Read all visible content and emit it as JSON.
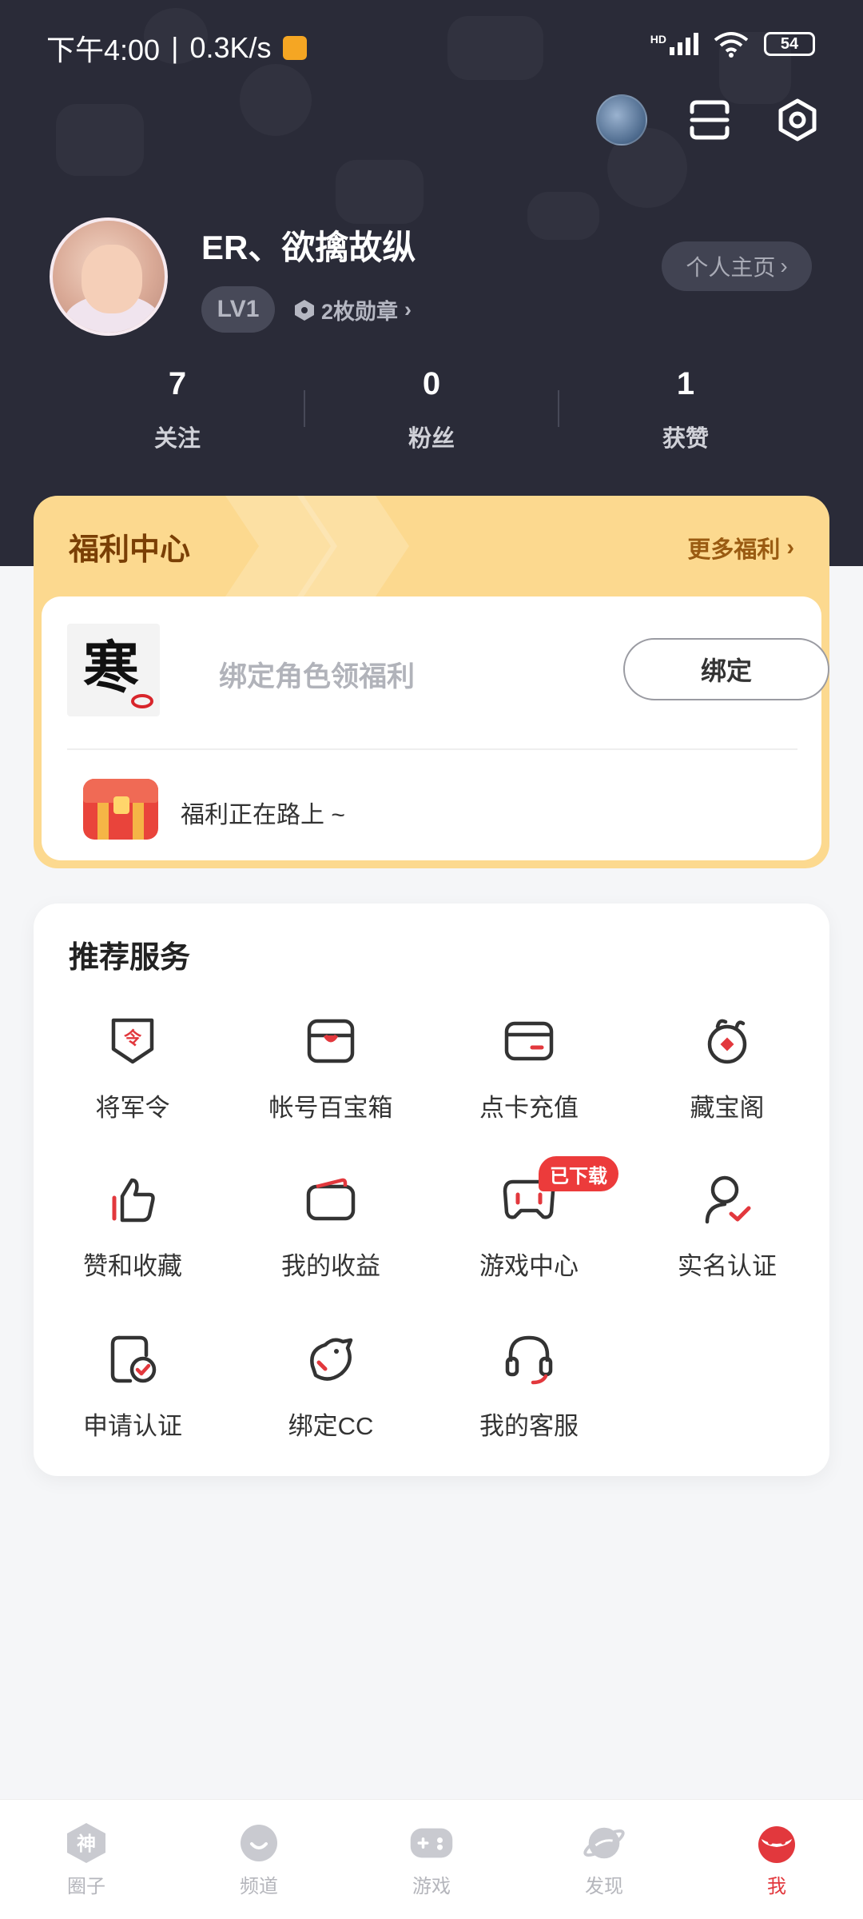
{
  "status_bar": {
    "time": "下午4:00",
    "speed": "0.3K/s",
    "network": "HD",
    "battery": "54"
  },
  "profile": {
    "username": "ER、欲擒故纵",
    "level": "LV1",
    "medals": "2枚勋章",
    "homepage_label": "个人主页"
  },
  "stats": [
    {
      "value": "7",
      "label": "关注"
    },
    {
      "value": "0",
      "label": "粉丝"
    },
    {
      "value": "1",
      "label": "获赞"
    }
  ],
  "welfare": {
    "title": "福利中心",
    "more_label": "更多福利",
    "bind_hint": "绑定角色领福利",
    "bind_button": "绑定",
    "status_text": "福利正在路上 ~"
  },
  "services": {
    "title": "推荐服务",
    "items": [
      {
        "label": "将军令",
        "icon": "shield-token-icon"
      },
      {
        "label": "帐号百宝箱",
        "icon": "treasure-box-icon"
      },
      {
        "label": "点卡充值",
        "icon": "card-icon"
      },
      {
        "label": "藏宝阁",
        "icon": "treasure-pavilion-icon"
      },
      {
        "label": "赞和收藏",
        "icon": "thumbs-up-icon"
      },
      {
        "label": "我的收益",
        "icon": "wallet-icon"
      },
      {
        "label": "游戏中心",
        "icon": "gamepad-icon"
      },
      {
        "label": "实名认证",
        "icon": "user-verify-icon"
      },
      {
        "label": "申请认证",
        "icon": "document-check-icon"
      },
      {
        "label": "绑定CC",
        "icon": "cc-bird-icon"
      },
      {
        "label": "我的客服",
        "icon": "headset-icon"
      }
    ],
    "download_badge": "已下载"
  },
  "tabs": [
    {
      "label": "圈子",
      "icon": "shen-icon",
      "active": false
    },
    {
      "label": "频道",
      "icon": "channel-icon",
      "active": false
    },
    {
      "label": "游戏",
      "icon": "gamepad-icon",
      "active": false
    },
    {
      "label": "发现",
      "icon": "planet-icon",
      "active": false
    },
    {
      "label": "我",
      "icon": "me-mask-icon",
      "active": true
    }
  ],
  "colors": {
    "header_bg": "#2a2b38",
    "welfare_bg": "#fcd98f",
    "accent_red": "#e2383d",
    "page_bg": "#f5f6f8"
  }
}
